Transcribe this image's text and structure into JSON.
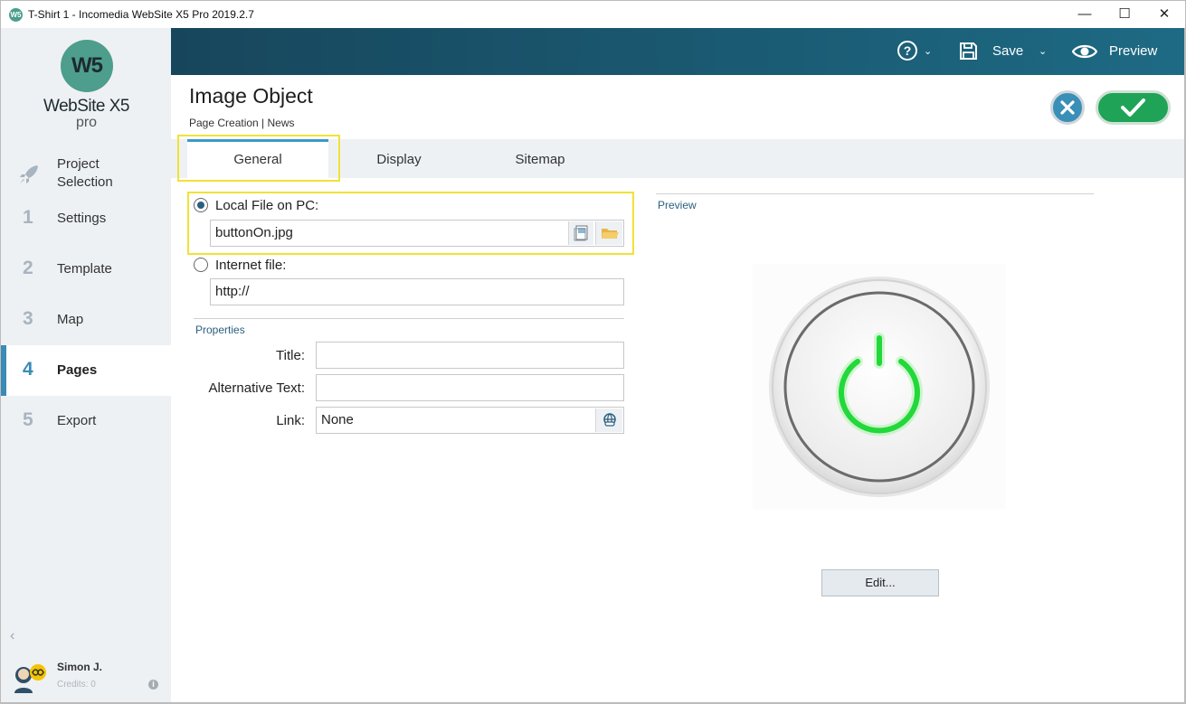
{
  "window": {
    "title": "T-Shirt 1 - Incomedia WebSite X5 Pro 2019.2.7",
    "app_icon_text": "W5",
    "controls": {
      "minimize": "—",
      "maximize": "☐",
      "close": "✕"
    }
  },
  "sidebar": {
    "logo_text": "W5",
    "logo_name": "WebSite X5",
    "logo_edition": "pro",
    "items": [
      {
        "num": "",
        "label": "Project\nSelection",
        "icon": "rocket-icon",
        "active": false
      },
      {
        "num": "1",
        "label": "Settings",
        "active": false
      },
      {
        "num": "2",
        "label": "Template",
        "active": false
      },
      {
        "num": "3",
        "label": "Map",
        "active": false
      },
      {
        "num": "4",
        "label": "Pages",
        "active": true
      },
      {
        "num": "5",
        "label": "Export",
        "active": false
      }
    ],
    "collapse_glyph": "‹",
    "user": {
      "name": "Simon J.",
      "credits": "Credits: 0"
    },
    "info_glyph": "i"
  },
  "toolbar": {
    "help_glyph": "?",
    "save_label": "Save",
    "preview_label": "Preview",
    "caret": "⌄"
  },
  "header": {
    "title": "Image Object",
    "breadcrumb": "Page Creation | News"
  },
  "tabs": [
    {
      "label": "General",
      "active": true
    },
    {
      "label": "Display",
      "active": false
    },
    {
      "label": "Sitemap",
      "active": false
    }
  ],
  "general": {
    "local_file_label": "Local File on PC:",
    "local_file_value": "buttonOn.jpg",
    "internet_file_label": "Internet file:",
    "internet_file_value": "http://",
    "properties_label": "Properties",
    "title_label": "Title:",
    "title_value": "",
    "alt_label": "Alternative Text:",
    "alt_value": "",
    "link_label": "Link:",
    "link_value": "None"
  },
  "preview": {
    "label": "Preview",
    "edit_button": "Edit..."
  },
  "colors": {
    "accent": "#3a8bb5",
    "topband": "#17465c",
    "ok_green": "#1fa356",
    "highlight": "#f0e236"
  }
}
